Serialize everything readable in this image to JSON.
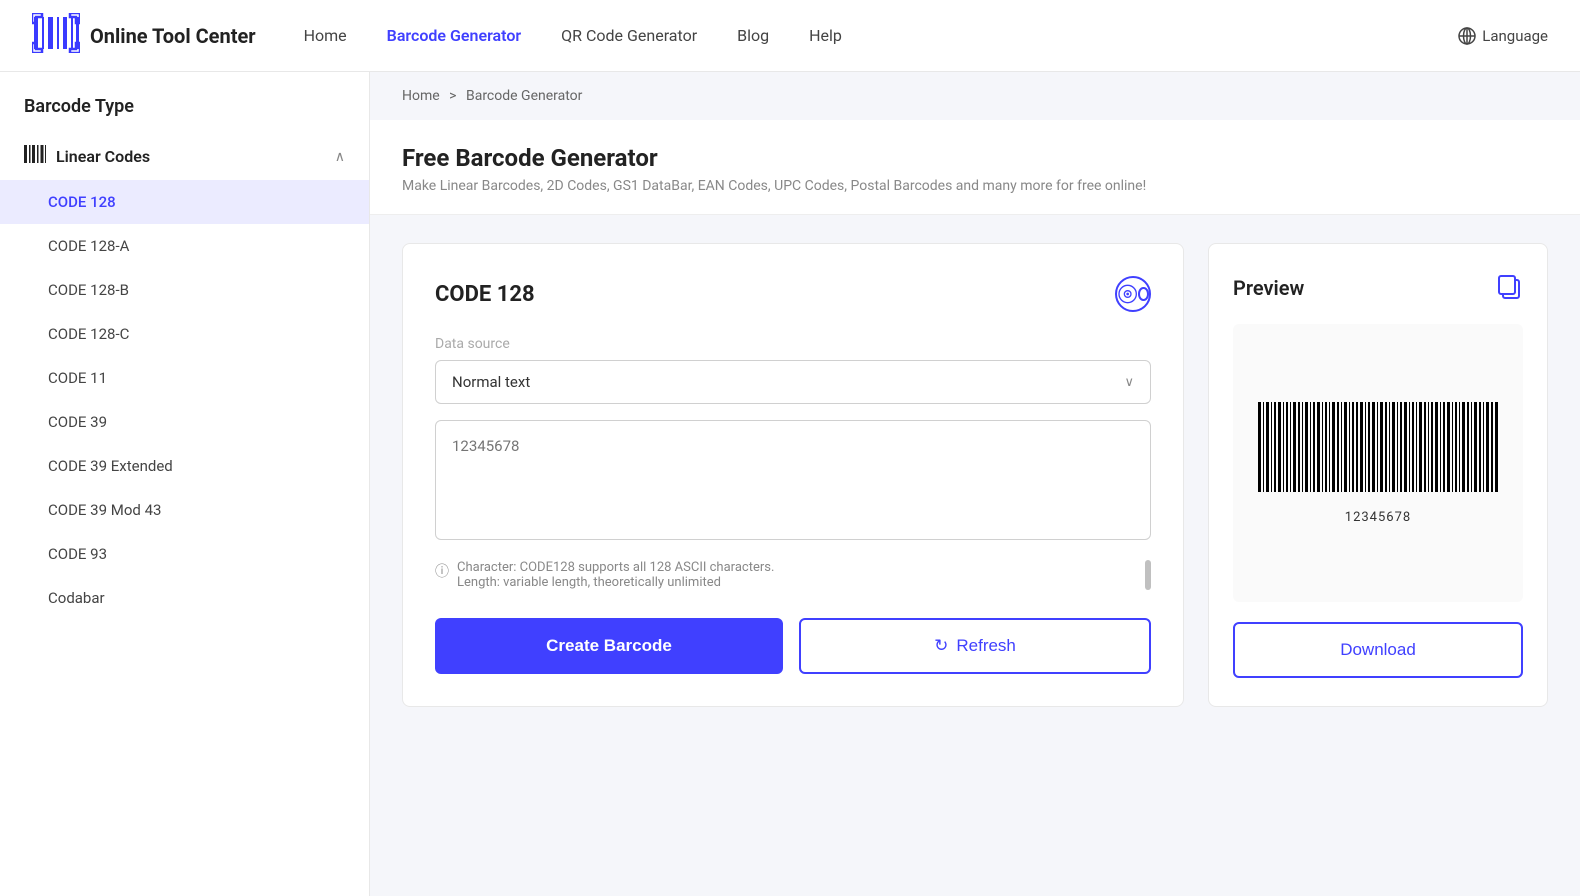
{
  "header": {
    "logo_icon": "▌▌▌▌▌",
    "logo_text": "Online Tool Center",
    "nav_items": [
      {
        "label": "Home",
        "active": false
      },
      {
        "label": "Barcode Generator",
        "active": true
      },
      {
        "label": "QR Code Generator",
        "active": false
      },
      {
        "label": "Blog",
        "active": false
      },
      {
        "label": "Help",
        "active": false
      }
    ],
    "language_label": "Language"
  },
  "sidebar": {
    "section_title": "Barcode Type",
    "group_label": "Linear Codes",
    "items": [
      {
        "label": "CODE 128",
        "active": true
      },
      {
        "label": "CODE 128-A",
        "active": false
      },
      {
        "label": "CODE 128-B",
        "active": false
      },
      {
        "label": "CODE 128-C",
        "active": false
      },
      {
        "label": "CODE 11",
        "active": false
      },
      {
        "label": "CODE 39",
        "active": false
      },
      {
        "label": "CODE 39 Extended",
        "active": false
      },
      {
        "label": "CODE 39 Mod 43",
        "active": false
      },
      {
        "label": "CODE 93",
        "active": false
      },
      {
        "label": "Codabar",
        "active": false
      }
    ]
  },
  "breadcrumb": {
    "home": "Home",
    "separator": ">",
    "current": "Barcode Generator"
  },
  "page_title": "Free Barcode Generator",
  "page_subtitle": "Make Linear Barcodes, 2D Codes, GS1 DataBar, EAN Codes, UPC Codes, Postal Barcodes and many more for free online!",
  "generator": {
    "title": "CODE 128",
    "data_source_label": "Data source",
    "dropdown_value": "Normal text",
    "textarea_placeholder": "12345678",
    "info_text_line1": "Character: CODE128 supports all 128 ASCII characters.",
    "info_text_line2": "Length: variable length, theoretically unlimited",
    "create_button": "Create Barcode",
    "refresh_button": "Refresh",
    "refresh_icon": "↻"
  },
  "preview": {
    "title": "Preview",
    "barcode_value": "12345678",
    "download_button": "Download"
  }
}
